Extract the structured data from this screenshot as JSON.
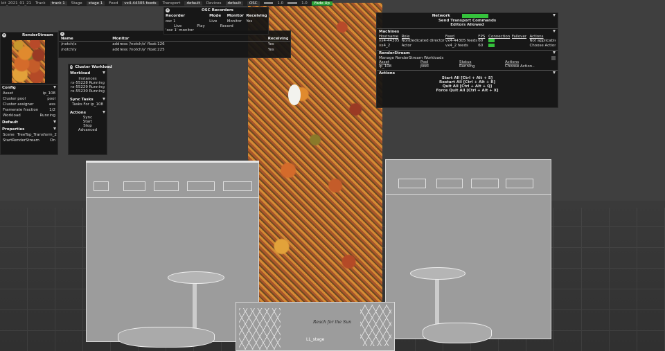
{
  "topbar": {
    "file": "kit_2021_01_21",
    "track_label": "Track",
    "track": "track 1",
    "stage_label": "Stage",
    "stage": "stage 1",
    "feed_label": "Feed",
    "feed": "vx4-44305 feeds",
    "transport_label": "Transport",
    "transport": "default",
    "devices_label": "Devices",
    "devices": "default",
    "osc": "OSC",
    "v1": "1.0",
    "v2": "1.0",
    "fade": "Fade Up"
  },
  "renderstream_thumb": {
    "title": "RenderStream"
  },
  "osc_recorders": {
    "title": "OSC Recorders",
    "cols": [
      "Recorder",
      "Mode",
      "Monitor",
      "Receiving"
    ],
    "row": [
      "osc 1",
      "Live",
      "Monitor",
      "Yes"
    ],
    "row2": [
      "Live",
      "Play",
      "Record"
    ],
    "footer": "'osc 1' monitor"
  },
  "monitor": {
    "cols": [
      "Name",
      "Monitor",
      "Receiving"
    ],
    "rows": [
      [
        "/notch/x",
        "address:'/notch/x' float:126",
        "Yes"
      ],
      [
        "/notch/y",
        "address:'/notch/y' float:225",
        "Yes"
      ]
    ]
  },
  "config": {
    "title": "Config",
    "rows": [
      [
        "Asset",
        "ip_108"
      ],
      [
        "Cluster pool",
        "pool"
      ],
      [
        "Cluster assigner",
        "ass"
      ],
      [
        "Framerate fraction",
        "1/2"
      ],
      [
        "Workload",
        "Running"
      ]
    ],
    "default_label": "Default",
    "properties_label": "Properties",
    "scene_label": "Scene",
    "scene_value": "TreeTop_Transform_2",
    "start_label": "StartRenderStream",
    "start_value": "On"
  },
  "cluster": {
    "title": "Cluster Workload",
    "workload": "Workload",
    "instances": "Instances",
    "rows": [
      [
        "rx-55228",
        "Running"
      ],
      [
        "rx-55229",
        "Running"
      ],
      [
        "rx-55230",
        "Running"
      ]
    ],
    "sync_title": "Sync Tasks",
    "tasks_for": "Tasks For ip_108",
    "actions_title": "Actions",
    "actions": [
      "Sync",
      "Start",
      "Stop",
      "Advanced"
    ]
  },
  "network": {
    "title": "Network",
    "send": "Send Transport Commands",
    "editors": "Editors Allowed",
    "machines_title": "Machines",
    "machine_cols": [
      "Hostname",
      "Role",
      "Feed",
      "FPS",
      "Connection",
      "Failover",
      "Actions"
    ],
    "machines": [
      [
        "vx4-44305",
        "NonDedicated director",
        "vx4-44305 feeds",
        "60",
        "",
        "",
        "Not applicable"
      ],
      [
        "vx4_2",
        "Actor",
        "vx4_2 feeds",
        "60",
        "",
        "",
        "Choose Action.."
      ]
    ],
    "rs_title": "RenderStream",
    "manage": "Manage RenderStream Workloads",
    "rs_cols": [
      "Asset",
      "Pool",
      "Status",
      "Actions"
    ],
    "rs_row": [
      "ip_108",
      "pool",
      "Running",
      "Choose Action.."
    ],
    "actions_title": "Actions",
    "actions": [
      "Start All [Ctrl + Alt + S]",
      "Restart All [Ctrl + Alt + R]",
      "Quit All [Ctrl + Alt + Q]",
      "Force Quit All [Ctrl + Alt + X]"
    ],
    "accent": "#35c13c"
  },
  "stage": {
    "label": "LL_stage",
    "sign": "Reach for the Sun"
  }
}
